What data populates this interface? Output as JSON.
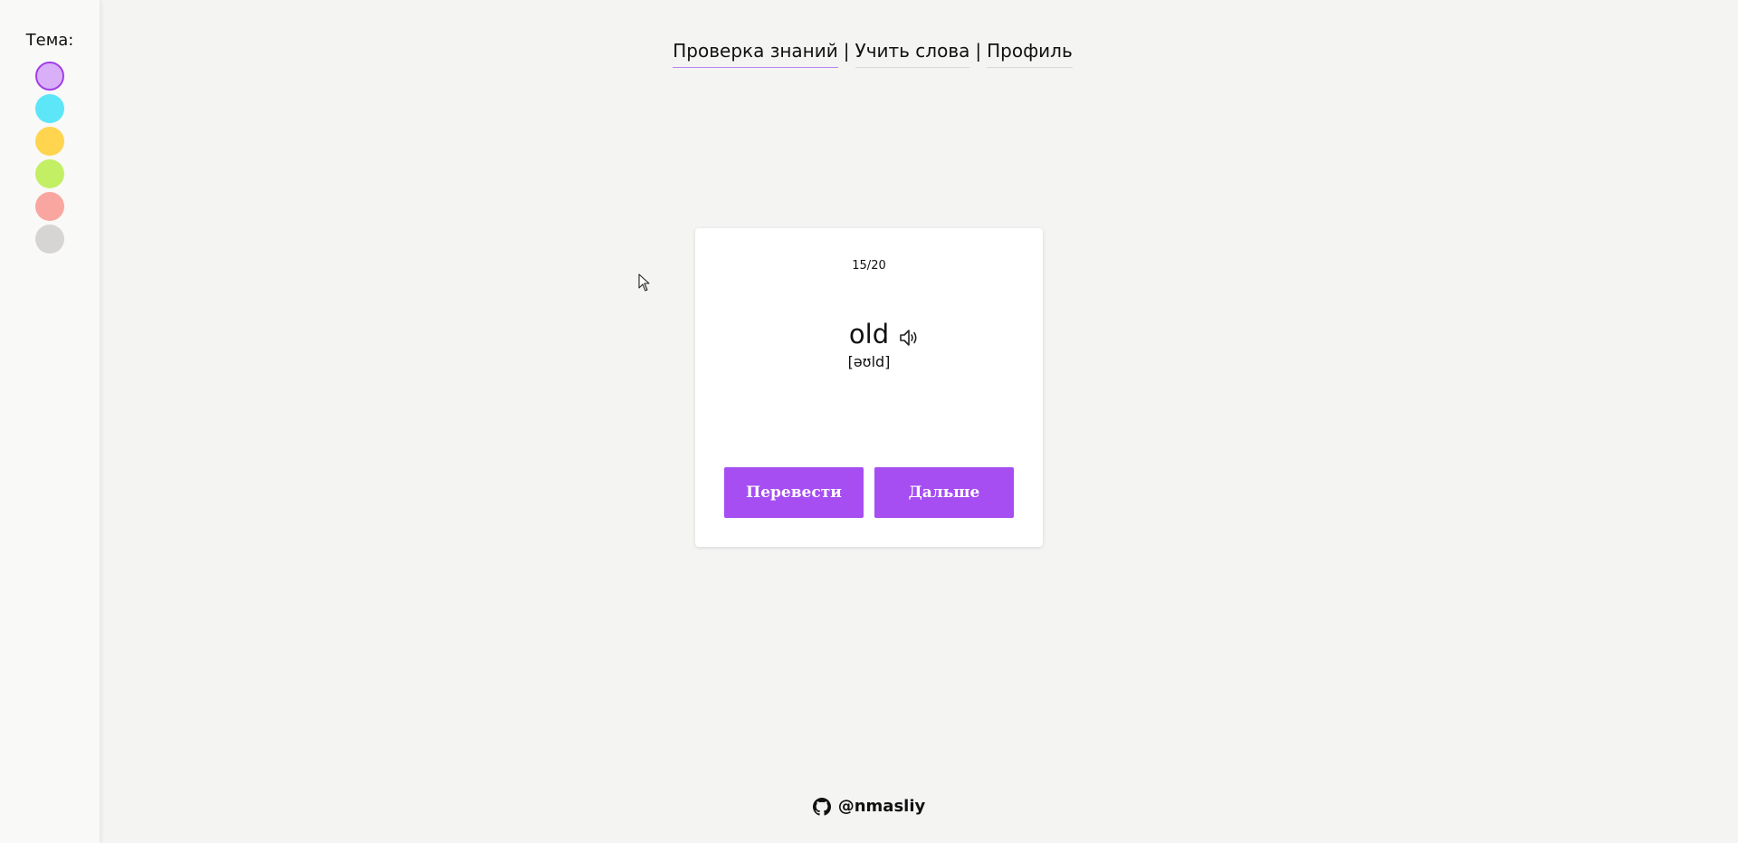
{
  "sidebar": {
    "theme_label": "Тема:",
    "themes": [
      {
        "name": "purple",
        "color": "#d9b0f7",
        "active": true
      },
      {
        "name": "cyan",
        "color": "#5ce6f8",
        "active": false
      },
      {
        "name": "yellow",
        "color": "#ffd54f",
        "active": false
      },
      {
        "name": "green",
        "color": "#c2ef64",
        "active": false
      },
      {
        "name": "pink",
        "color": "#f9a6a1",
        "active": false
      },
      {
        "name": "gray",
        "color": "#d7d5d3",
        "active": false
      }
    ]
  },
  "nav": {
    "items": [
      "Проверка знаний",
      "Учить слова",
      "Профиль"
    ],
    "separator": "|",
    "active": "Проверка знаний"
  },
  "card": {
    "counter": "15/20",
    "word": "old",
    "transcription": "[əʊld]",
    "translate_label": "Перевести",
    "next_label": "Дальше",
    "accent_color": "#a64ef2"
  },
  "footer": {
    "handle": "@nmasliy"
  }
}
